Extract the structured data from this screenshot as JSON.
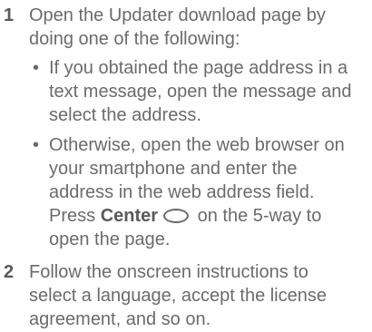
{
  "steps": [
    {
      "number": "1",
      "lines": [
        "Open the Updater download page by",
        "doing one of the following:"
      ],
      "bullets": [
        {
          "lines": [
            "If you obtained the page address in a",
            "text message, open the message and",
            "select the address."
          ]
        },
        {
          "lines": [
            "Otherwise, open the web browser on",
            "your smartphone and enter the",
            "address in the web address field."
          ],
          "press_prefix": "Press ",
          "press_key": "Center",
          "press_suffix": " on the 5-way to",
          "last_line": "open the page."
        }
      ]
    },
    {
      "number": "2",
      "lines": [
        "Follow the onscreen instructions to",
        "select a language, accept the license",
        "agreement, and so on."
      ]
    }
  ],
  "icons": {
    "bullet": "bullet-dot",
    "center_key": "center-button-icon"
  }
}
